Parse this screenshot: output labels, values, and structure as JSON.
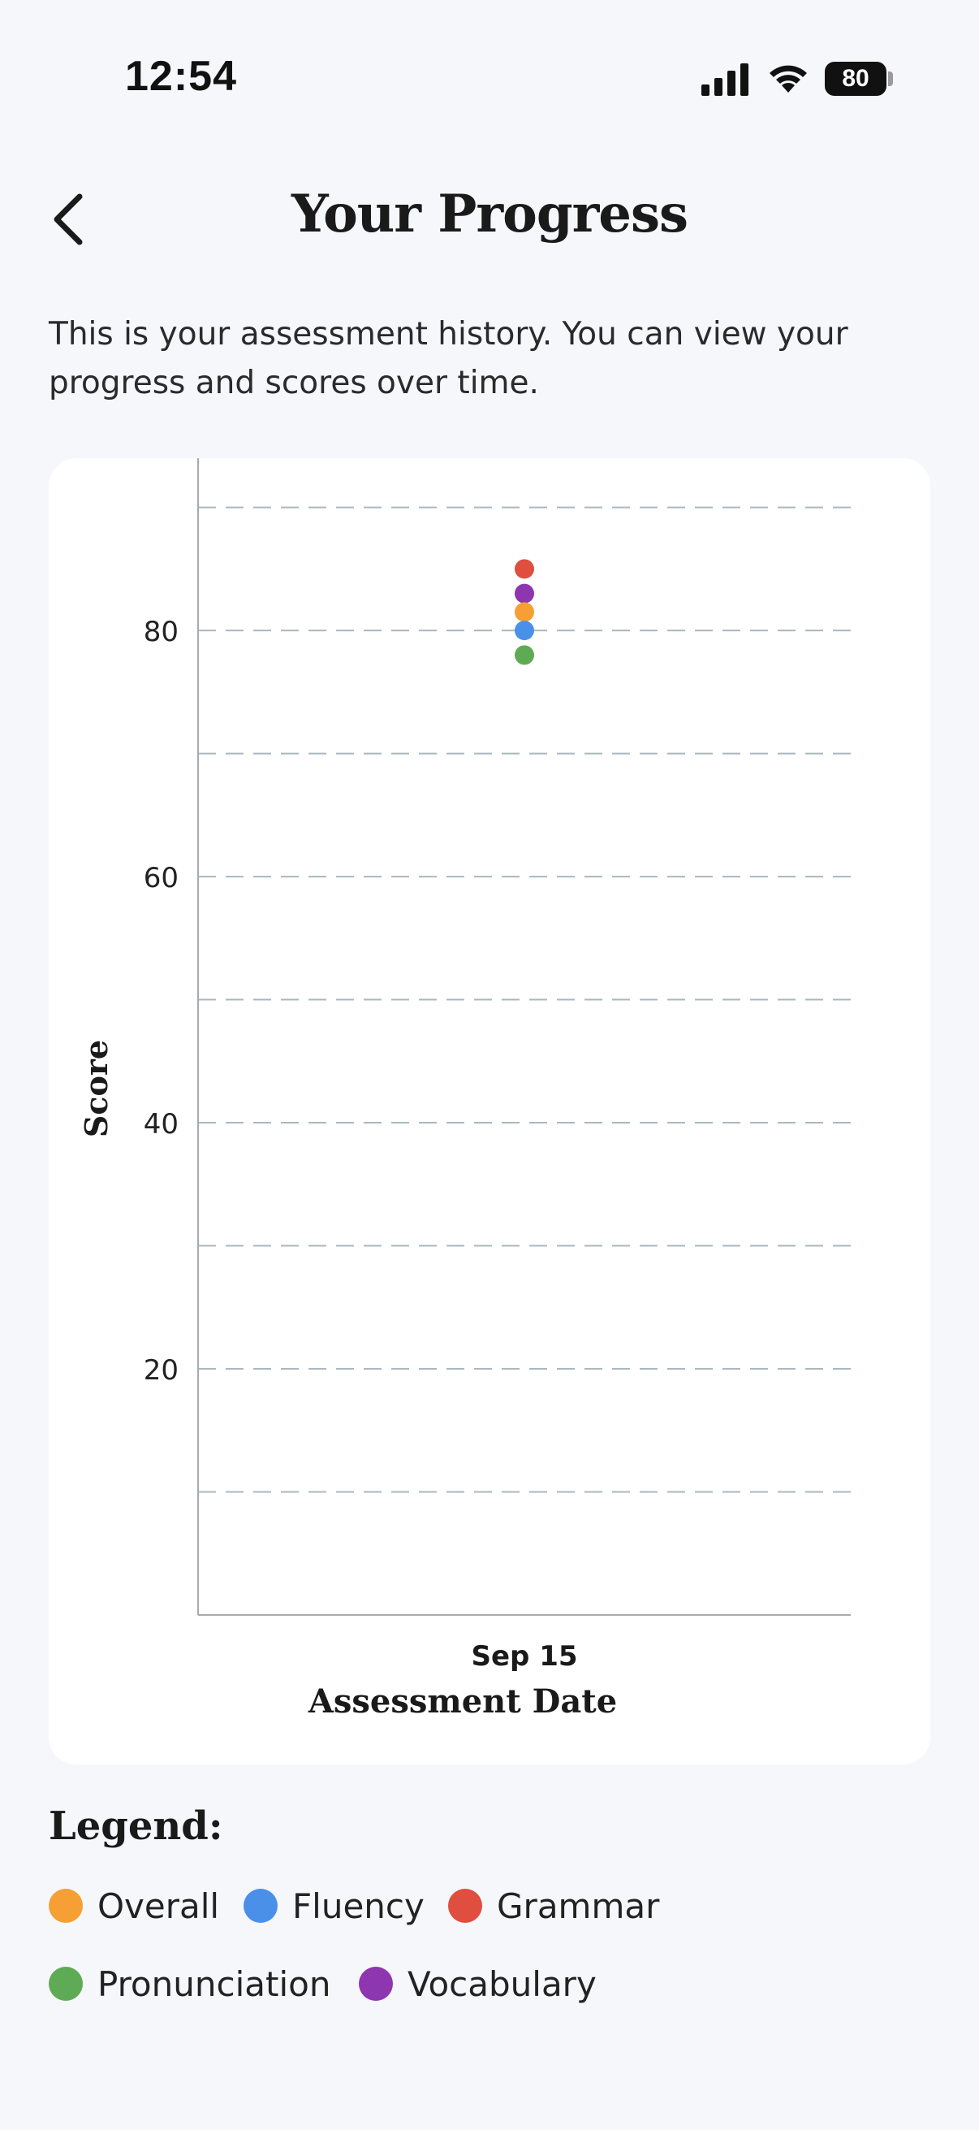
{
  "status_bar": {
    "time": "12:54",
    "battery": "80"
  },
  "header": {
    "title": "Your Progress"
  },
  "description": "This is your assessment history. You can view your progress and scores over time.",
  "legend": {
    "title": "Legend:",
    "items": [
      {
        "label": "Overall",
        "color": "#f59f35"
      },
      {
        "label": "Fluency",
        "color": "#4a90e8"
      },
      {
        "label": "Grammar",
        "color": "#e04e3f"
      },
      {
        "label": "Pronunciation",
        "color": "#5fab55"
      },
      {
        "label": "Vocabulary",
        "color": "#8e35b0"
      }
    ]
  },
  "chart_data": {
    "type": "scatter",
    "xlabel": "Assessment Date",
    "ylabel": "Score",
    "categories": [
      "Sep 15"
    ],
    "ylim": [
      0,
      94
    ],
    "yticks": [
      20,
      40,
      60,
      80
    ],
    "gridlines": [
      10,
      20,
      30,
      40,
      50,
      60,
      70,
      80,
      90
    ],
    "grid": true,
    "series": [
      {
        "name": "Grammar",
        "color": "#e04e3f",
        "values": [
          85
        ]
      },
      {
        "name": "Vocabulary",
        "color": "#8e35b0",
        "values": [
          83
        ]
      },
      {
        "name": "Overall",
        "color": "#f59f35",
        "values": [
          81.5
        ]
      },
      {
        "name": "Fluency",
        "color": "#4a90e8",
        "values": [
          80
        ]
      },
      {
        "name": "Pronunciation",
        "color": "#5fab55",
        "values": [
          78
        ]
      }
    ]
  }
}
